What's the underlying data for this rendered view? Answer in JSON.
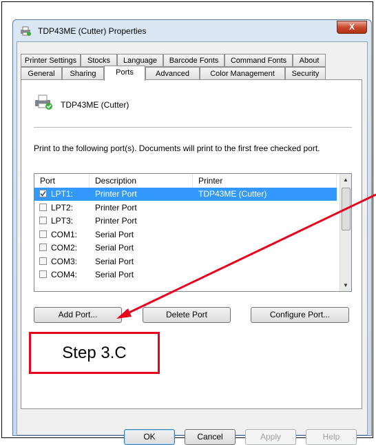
{
  "window": {
    "title": "TDP43ME (Cutter) Properties",
    "close_label": "X"
  },
  "tabs": {
    "row1": [
      "Printer Settings",
      "Stocks",
      "Language",
      "Barcode Fonts",
      "Command Fonts",
      "About"
    ],
    "row2": [
      "General",
      "Sharing",
      "Ports",
      "Advanced",
      "Color Management",
      "Security"
    ],
    "selected": "Ports"
  },
  "ports_panel": {
    "printer_name": "TDP43ME (Cutter)",
    "instruction": "Print to the following port(s). Documents will print to the first free checked port.",
    "columns": {
      "port": "Port",
      "description": "Description",
      "printer": "Printer"
    },
    "rows": [
      {
        "port": "LPT1:",
        "description": "Printer Port",
        "printer": "TDP43ME (Cutter)",
        "checked": true,
        "selected": true
      },
      {
        "port": "LPT2:",
        "description": "Printer Port",
        "printer": "",
        "checked": false,
        "selected": false
      },
      {
        "port": "LPT3:",
        "description": "Printer Port",
        "printer": "",
        "checked": false,
        "selected": false
      },
      {
        "port": "COM1:",
        "description": "Serial Port",
        "printer": "",
        "checked": false,
        "selected": false
      },
      {
        "port": "COM2:",
        "description": "Serial Port",
        "printer": "",
        "checked": false,
        "selected": false
      },
      {
        "port": "COM3:",
        "description": "Serial Port",
        "printer": "",
        "checked": false,
        "selected": false
      },
      {
        "port": "COM4:",
        "description": "Serial Port",
        "printer": "",
        "checked": false,
        "selected": false
      }
    ],
    "add_port": "Add Port...",
    "delete_port": "Delete Port",
    "configure_port": "Configure Port..."
  },
  "footer": {
    "ok": "OK",
    "cancel": "Cancel",
    "apply": "Apply",
    "help": "Help"
  },
  "annotation": {
    "step_label": "Step 3.C",
    "color": "#e8001c"
  }
}
